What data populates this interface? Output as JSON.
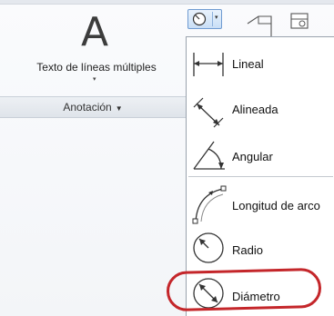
{
  "ribbon": {
    "big_letter": "A",
    "mtext_label": "Texto de líneas múltiples",
    "panel_title": "Anotación",
    "panel_arrow": "▼",
    "mtext_dropdown": "▾",
    "dim_btn_arrow": "▾"
  },
  "menu": {
    "items": [
      {
        "label": "Lineal",
        "icon": "linear-dim-icon"
      },
      {
        "label": "Alineada",
        "icon": "aligned-dim-icon"
      },
      {
        "label": "Angular",
        "icon": "angular-dim-icon"
      },
      {
        "label": "Longitud de arco",
        "icon": "arc-length-dim-icon"
      },
      {
        "label": "Radio",
        "icon": "radius-dim-icon"
      },
      {
        "label": "Diámetro",
        "icon": "diameter-dim-icon"
      }
    ]
  },
  "colors": {
    "highlight_ring": "#c4262a",
    "button_border": "#6f9bd1"
  }
}
